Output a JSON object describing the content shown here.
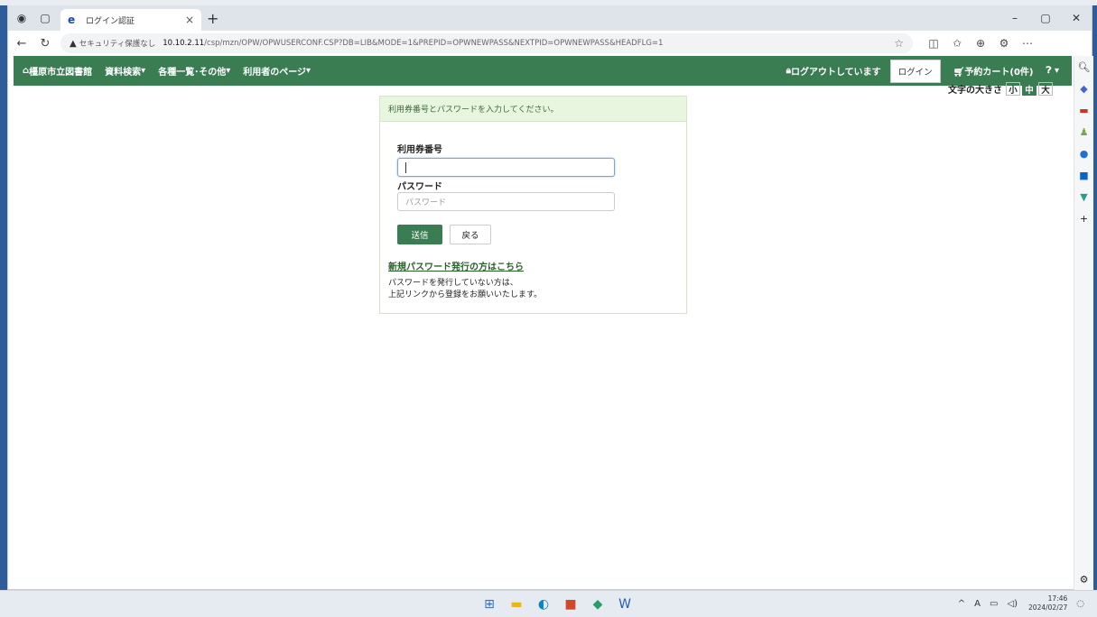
{
  "browser": {
    "tab_title": "ログイン認証",
    "tab_close": "×",
    "new_tab": "+",
    "security_label": "セキュリティ保護なし",
    "url_host": "10.10.2.11",
    "url_path": "/csp/mzn/OPW/OPWUSERCONF.CSP?DB=LIB&MODE=1&PREPID=OPWNEWPASS&NEXTPID=OPWNEWPASS&HEADFLG=1"
  },
  "site_nav": {
    "home": "橿原市立図書館",
    "search": "資料検索",
    "lists": "各種一覧･その他",
    "user_page": "利用者のページ",
    "logout_status": "ログアウトしています",
    "login_button": "ログイン",
    "cart": "予約カート(0件)"
  },
  "font_size": {
    "label": "文字の大きさ",
    "small": "小",
    "medium": "中",
    "large": "大",
    "selected": "中"
  },
  "login_form": {
    "header_message": "利用券番号とパスワードを入力してください。",
    "card_number_label": "利用券番号",
    "card_number_value": "",
    "password_label": "パスワード",
    "password_placeholder": "パスワード",
    "submit_button": "送信",
    "back_button": "戻る",
    "new_password_link": "新規パスワード発行の方はこちら",
    "note_line1": "パスワードを発行していない方は、",
    "note_line2": "上記リンクから登録をお願いいたします。"
  },
  "taskbar": {
    "time": "17:46",
    "date": "2024/02/27"
  },
  "colors": {
    "header_green": "#3a7d52",
    "card_head_bg": "#e8f6e0"
  }
}
